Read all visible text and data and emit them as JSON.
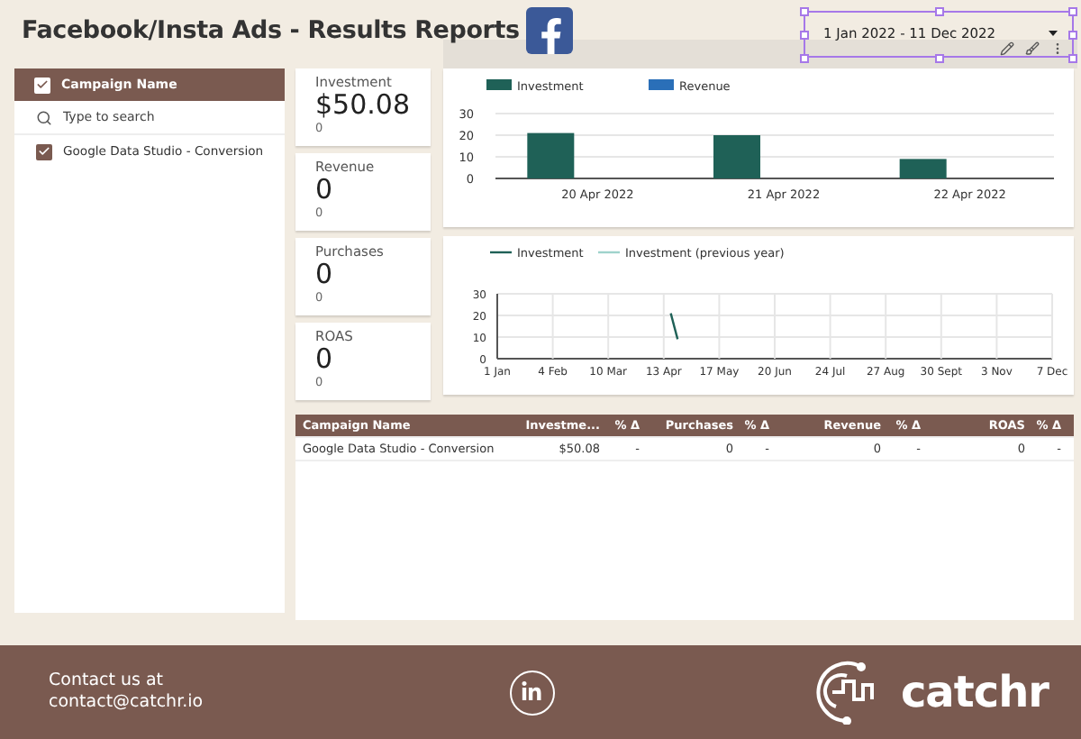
{
  "header": {
    "title": "Facebook/Insta Ads - Results Reports",
    "date_range": "1 Jan 2022 - 11 Dec 2022"
  },
  "filter": {
    "header": {
      "label": "Campaign Name",
      "checked": true
    },
    "search": {
      "placeholder": "Type to search"
    },
    "items": [
      {
        "label": "Google Data Studio - Conversion",
        "checked": true
      }
    ]
  },
  "kpis": [
    {
      "label": "Investment",
      "value": "$50.08",
      "delta": "0"
    },
    {
      "label": "Revenue",
      "value": "0",
      "delta": "0"
    },
    {
      "label": "Purchases",
      "value": "0",
      "delta": "0"
    },
    {
      "label": "ROAS",
      "value": "0",
      "delta": "0"
    }
  ],
  "bar_chart": {
    "chart_data": {
      "type": "bar",
      "grid": true,
      "categories": [
        "20 Apr 2022",
        "21 Apr 2022",
        "22 Apr 2022"
      ],
      "ylim": [
        0,
        30
      ],
      "yticks": [
        0,
        10,
        20,
        30
      ],
      "series": [
        {
          "name": "Investment",
          "color": "#1f6157",
          "values": [
            21,
            20,
            9
          ]
        },
        {
          "name": "Revenue",
          "color": "#2a6fb8",
          "values": [
            0,
            0,
            0
          ]
        }
      ]
    }
  },
  "line_chart": {
    "chart_data": {
      "type": "line",
      "grid": true,
      "ylim": [
        0,
        30
      ],
      "yticks": [
        0,
        10,
        20,
        30
      ],
      "categories": [
        "1 Jan",
        null,
        null,
        null,
        null,
        null,
        null,
        null,
        "4 Feb",
        null,
        null,
        null,
        null,
        null,
        null,
        null,
        "10 Mar",
        null,
        null,
        null,
        null,
        null,
        null,
        null,
        "13 Apr",
        null,
        null,
        null,
        null,
        null,
        null,
        null,
        "17 May",
        null,
        null,
        null,
        null,
        null,
        null,
        null,
        "20 Jun",
        null,
        null,
        null,
        null,
        null,
        null,
        null,
        "24 Jul",
        null,
        null,
        null,
        null,
        null,
        null,
        null,
        "27 Aug",
        null,
        null,
        null,
        null,
        null,
        null,
        null,
        "30 Sept",
        null,
        null,
        null,
        null,
        null,
        null,
        null,
        "3 Nov",
        null,
        null,
        null,
        null,
        null,
        null,
        null,
        "7 Dec"
      ],
      "series": [
        {
          "name": "Investment",
          "color": "#1f6157",
          "values": [
            null,
            null,
            null,
            null,
            null,
            null,
            null,
            null,
            null,
            null,
            null,
            null,
            null,
            null,
            null,
            null,
            null,
            null,
            null,
            null,
            null,
            null,
            null,
            null,
            null,
            21,
            9,
            null,
            null,
            null,
            null,
            null,
            null,
            null,
            null,
            null,
            null,
            null,
            null,
            null,
            null,
            null,
            null,
            null,
            null,
            null,
            null,
            null,
            null,
            null,
            null,
            null,
            null,
            null,
            null,
            null,
            null,
            null,
            null,
            null,
            null,
            null,
            null,
            null,
            null,
            null,
            null,
            null,
            null,
            null,
            null,
            null,
            null,
            null,
            null,
            null,
            null,
            null,
            null,
            null,
            null
          ]
        },
        {
          "name": "Investment (previous year)",
          "color": "#9fd3cc",
          "values": [
            null,
            null,
            null,
            null,
            null,
            null,
            null,
            null,
            null,
            null,
            null,
            null,
            null,
            null,
            null,
            null,
            null,
            null,
            null,
            null,
            null,
            null,
            null,
            null,
            null,
            null,
            null,
            null,
            null,
            null,
            null,
            null,
            null,
            null,
            null,
            null,
            null,
            null,
            null,
            null,
            null,
            null,
            null,
            null,
            null,
            null,
            null,
            null,
            null,
            null,
            null,
            null,
            null,
            null,
            null,
            null,
            null,
            null,
            null,
            null,
            null,
            null,
            null,
            null,
            null,
            null,
            null,
            null,
            null,
            null,
            null,
            null,
            null,
            null,
            null,
            null,
            null,
            null,
            null,
            null,
            null
          ]
        }
      ]
    }
  },
  "table": {
    "columns": [
      "Campaign Name",
      "Investme...",
      "% Δ",
      "Purchases",
      "% Δ",
      "Revenue",
      "% Δ",
      "ROAS",
      "% Δ"
    ],
    "rows": [
      [
        "Google Data Studio - Conversion",
        "$50.08",
        "-",
        "0",
        "-",
        "0",
        "-",
        "0",
        "-"
      ]
    ]
  },
  "footer": {
    "contact_lines": [
      "Contact us at",
      "contact@catchr.io"
    ],
    "brand": "catchr"
  }
}
